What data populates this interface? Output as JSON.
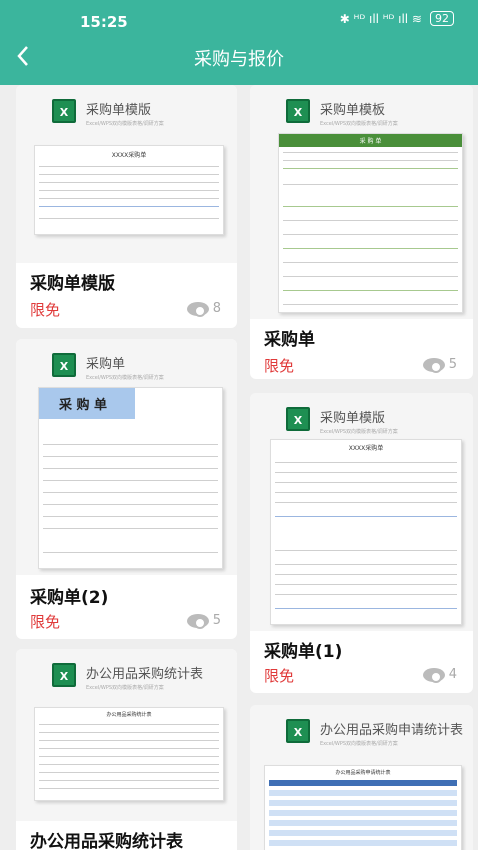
{
  "status": {
    "time": "15:25",
    "icons": "✱ ᴴᴰ ıll ᴴᴰ ıll ≋",
    "battery": "92"
  },
  "header": {
    "title": "采购与报价",
    "back_icon": "arrow-left-icon"
  },
  "cards": [
    {
      "thumb_title": "采购单模版",
      "thumb_sub": "Excel/WPS双向模版表格/调研方案",
      "name": "采购单模版",
      "badge": "限免",
      "views": "8",
      "sheet_title": "XXXX采购单"
    },
    {
      "thumb_title": "采购单模板",
      "thumb_sub": "Excel/WPS双向模版表格/调研方案",
      "name": "采购单",
      "badge": "限免",
      "views": "5",
      "sheet_title": "采 购 单"
    },
    {
      "thumb_title": "采购单",
      "thumb_sub": "Excel/WPS双向模版表格/调研方案",
      "name": "采购单(2)",
      "badge": "限免",
      "views": "5",
      "sheet_title": "采 购 单"
    },
    {
      "thumb_title": "采购单模版",
      "thumb_sub": "Excel/WPS双向模版表格/调研方案",
      "name": "采购单(1)",
      "badge": "限免",
      "views": "4",
      "sheet_title": "XXXX采购单"
    },
    {
      "thumb_title": "办公用品采购统计表",
      "thumb_sub": "Excel/WPS双向模版表格/调研方案",
      "name": "办公用品采购统计表",
      "sheet_title": "办公用品采购统计表"
    },
    {
      "thumb_title": "办公用品采购申请统计表",
      "thumb_sub": "Excel/WPS双向模版表格/调研方案",
      "sheet_title": "办公用品采购申请统计表"
    }
  ]
}
